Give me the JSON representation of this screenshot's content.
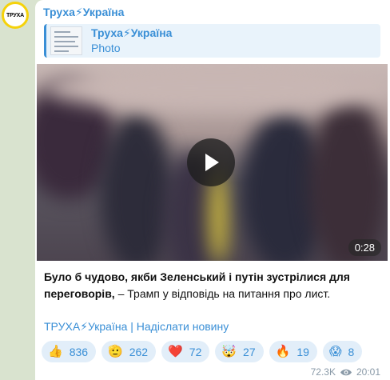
{
  "avatar": {
    "label": "ТРУХА"
  },
  "header": {
    "channel_name": "Труха⚡Україна"
  },
  "reply": {
    "title": "Труха⚡Україна",
    "subtitle": "Photo"
  },
  "video": {
    "duration": "0:28",
    "play_icon": "play-icon"
  },
  "message": {
    "bold": "Було б чудово, якби Зеленський і путін зустрілися для переговорів,",
    "rest": " – Трамп у відповідь на питання про лист."
  },
  "footer": {
    "text": "ТРУХА⚡Україна | Надіслати новину"
  },
  "reactions": [
    {
      "emoji": "👍",
      "count": "836"
    },
    {
      "emoji": "🫡",
      "count": "262"
    },
    {
      "emoji": "❤️",
      "count": "72"
    },
    {
      "emoji": "🤯",
      "count": "27"
    },
    {
      "emoji": "🔥",
      "count": "19"
    },
    {
      "emoji": "😱",
      "count": "8"
    }
  ],
  "meta": {
    "views": "72.3K",
    "time": "20:01"
  },
  "colors": {
    "accent": "#3a8fd6",
    "background": "#d9e3cf",
    "avatar_ring": "#f5d20a"
  }
}
